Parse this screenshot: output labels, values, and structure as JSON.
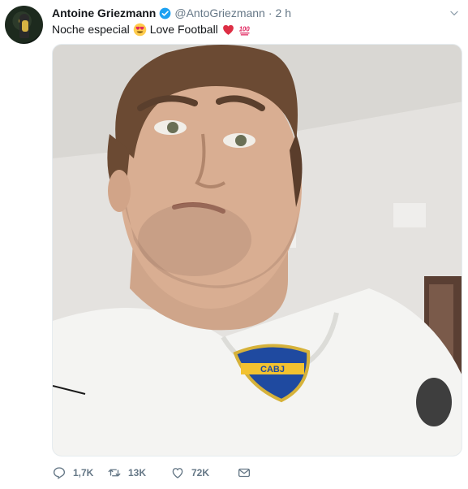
{
  "tweet": {
    "author_name": "Antoine Griezmann",
    "handle": "@AntoGriezmann",
    "separator": "·",
    "time": "2 h",
    "text_before": "Noche especial",
    "text_after": "Love Football",
    "icons": {
      "verified": "verified-badge-icon",
      "caret": "chevron-down-icon",
      "emoji1": "heart-eyes-emoji",
      "emoji2": "red-heart-emoji",
      "emoji3": "hundred-points-emoji"
    }
  },
  "photo": {
    "description_badge_text": "CABJ"
  },
  "actions": {
    "replies": "1,7K",
    "retweets": "13K",
    "likes": "72K"
  },
  "colors": {
    "verified": "#1da1f2",
    "muted": "#657786",
    "heart": "#e0245e"
  }
}
